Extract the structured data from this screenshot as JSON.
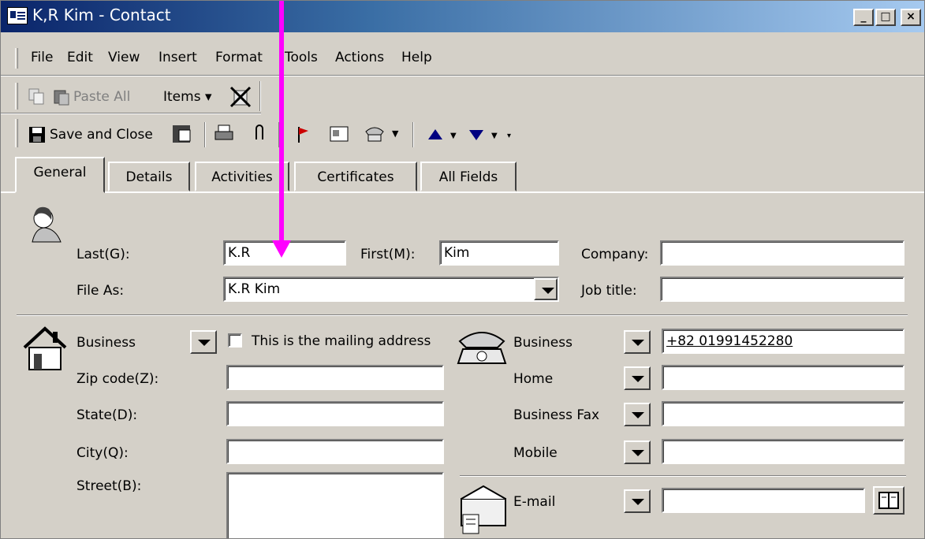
{
  "window": {
    "title": "K,R Kim - Contact",
    "minimize": "_",
    "maximize": "□",
    "close": "×"
  },
  "menu": [
    "File",
    "Edit",
    "View",
    "Insert",
    "Format",
    "Tools",
    "Actions",
    "Help"
  ],
  "toolbar1": {
    "paste_all": "Paste All",
    "items": "Items ▾"
  },
  "toolbar2": {
    "save_close": "Save and Close"
  },
  "tabs": [
    "General",
    "Details",
    "Activities",
    "Certificates",
    "All Fields"
  ],
  "name": {
    "last_label": "Last(G):",
    "last_value": "K.R",
    "first_label": "First(M):",
    "first_value": "Kim",
    "company_label": "Company:",
    "company_value": "",
    "file_as_label": "File As:",
    "file_as_value": "K.R Kim",
    "job_label": "Job title:",
    "job_value": ""
  },
  "address": {
    "type": "Business",
    "mailing_label": "This is the mailing address",
    "zip_label": "Zip code(Z):",
    "state_label": "State(D):",
    "city_label": "City(Q):",
    "street_label": "Street(B):"
  },
  "phones": [
    {
      "label": "Business",
      "value": "+82 01991452280"
    },
    {
      "label": "Home",
      "value": ""
    },
    {
      "label": "Business Fax",
      "value": ""
    },
    {
      "label": "Mobile",
      "value": ""
    }
  ],
  "email": {
    "label": "E-mail",
    "value": ""
  },
  "colors": {
    "highlight_arrow": "#ff00ff",
    "title_start": "#0a246a"
  }
}
